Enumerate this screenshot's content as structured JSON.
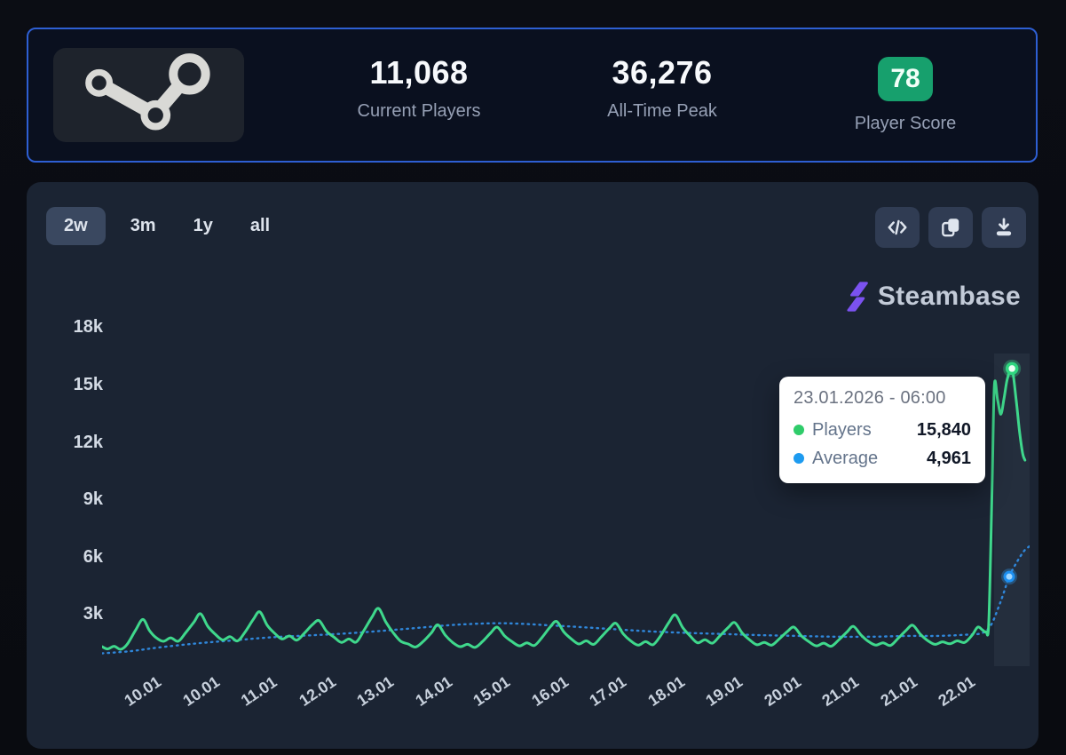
{
  "header": {
    "current_players": "11,068",
    "current_players_label": "Current Players",
    "all_time_peak": "36,276",
    "all_time_peak_label": "All-Time Peak",
    "player_score": "78",
    "player_score_label": "Player Score",
    "score_color": "#17a06d"
  },
  "toolbar": {
    "ranges": [
      {
        "label": "2w",
        "active": true
      },
      {
        "label": "3m",
        "active": false
      },
      {
        "label": "1y",
        "active": false
      },
      {
        "label": "all",
        "active": false
      }
    ],
    "icon_buttons": [
      "embed-code",
      "copy",
      "download"
    ]
  },
  "brand": {
    "name": "Steambase",
    "glyph_color": "#7b52f0"
  },
  "tooltip": {
    "date": "23.01.2026 - 06:00",
    "rows": [
      {
        "label": "Players",
        "value": "15,840",
        "color": "#2fcc6a"
      },
      {
        "label": "Average",
        "value": "4,961",
        "color": "#1d9bf0"
      }
    ]
  },
  "chart_data": {
    "type": "line",
    "ylim": [
      0,
      18400
    ],
    "y_ticks": [
      "18k",
      "15k",
      "12k",
      "9k",
      "6k",
      "3k"
    ],
    "y_tick_values": [
      18000,
      15000,
      12000,
      9000,
      6000,
      3000
    ],
    "x_ticks": [
      "10.01",
      "10.01",
      "11.01",
      "12.01",
      "13.01",
      "14.01",
      "15.01",
      "16.01",
      "17.01",
      "18.01",
      "19.01",
      "20.01",
      "21.01",
      "21.01",
      "22.01"
    ],
    "legend_position": "tooltip",
    "grid": false,
    "series": [
      {
        "name": "Players",
        "color": "#3fd88c",
        "style": "solid",
        "points": [
          [
            0.0,
            1300
          ],
          [
            0.006,
            1180
          ],
          [
            0.013,
            1320
          ],
          [
            0.02,
            1160
          ],
          [
            0.027,
            1420
          ],
          [
            0.036,
            2150
          ],
          [
            0.044,
            2720
          ],
          [
            0.051,
            2150
          ],
          [
            0.058,
            1780
          ],
          [
            0.066,
            1580
          ],
          [
            0.074,
            1760
          ],
          [
            0.082,
            1580
          ],
          [
            0.09,
            2020
          ],
          [
            0.099,
            2580
          ],
          [
            0.106,
            3020
          ],
          [
            0.114,
            2360
          ],
          [
            0.122,
            1950
          ],
          [
            0.13,
            1650
          ],
          [
            0.138,
            1820
          ],
          [
            0.146,
            1600
          ],
          [
            0.154,
            2050
          ],
          [
            0.163,
            2720
          ],
          [
            0.17,
            3120
          ],
          [
            0.178,
            2420
          ],
          [
            0.186,
            2000
          ],
          [
            0.194,
            1700
          ],
          [
            0.202,
            1860
          ],
          [
            0.21,
            1640
          ],
          [
            0.218,
            2000
          ],
          [
            0.227,
            2460
          ],
          [
            0.234,
            2660
          ],
          [
            0.242,
            2100
          ],
          [
            0.25,
            1800
          ],
          [
            0.258,
            1520
          ],
          [
            0.266,
            1700
          ],
          [
            0.274,
            1540
          ],
          [
            0.282,
            2120
          ],
          [
            0.291,
            2850
          ],
          [
            0.298,
            3300
          ],
          [
            0.306,
            2580
          ],
          [
            0.314,
            2020
          ],
          [
            0.322,
            1580
          ],
          [
            0.33,
            1440
          ],
          [
            0.338,
            1280
          ],
          [
            0.346,
            1560
          ],
          [
            0.355,
            2020
          ],
          [
            0.362,
            2440
          ],
          [
            0.37,
            1900
          ],
          [
            0.378,
            1520
          ],
          [
            0.386,
            1300
          ],
          [
            0.394,
            1420
          ],
          [
            0.402,
            1260
          ],
          [
            0.41,
            1560
          ],
          [
            0.419,
            2020
          ],
          [
            0.426,
            2320
          ],
          [
            0.434,
            1860
          ],
          [
            0.442,
            1560
          ],
          [
            0.45,
            1340
          ],
          [
            0.458,
            1500
          ],
          [
            0.466,
            1360
          ],
          [
            0.474,
            1760
          ],
          [
            0.483,
            2320
          ],
          [
            0.49,
            2620
          ],
          [
            0.498,
            2060
          ],
          [
            0.506,
            1700
          ],
          [
            0.514,
            1440
          ],
          [
            0.522,
            1600
          ],
          [
            0.53,
            1420
          ],
          [
            0.538,
            1800
          ],
          [
            0.547,
            2260
          ],
          [
            0.554,
            2520
          ],
          [
            0.562,
            1960
          ],
          [
            0.57,
            1600
          ],
          [
            0.578,
            1380
          ],
          [
            0.586,
            1560
          ],
          [
            0.594,
            1400
          ],
          [
            0.602,
            1860
          ],
          [
            0.611,
            2560
          ],
          [
            0.618,
            2960
          ],
          [
            0.626,
            2300
          ],
          [
            0.634,
            1860
          ],
          [
            0.642,
            1500
          ],
          [
            0.65,
            1660
          ],
          [
            0.658,
            1480
          ],
          [
            0.666,
            1860
          ],
          [
            0.675,
            2300
          ],
          [
            0.682,
            2560
          ],
          [
            0.69,
            2020
          ],
          [
            0.698,
            1660
          ],
          [
            0.706,
            1400
          ],
          [
            0.714,
            1520
          ],
          [
            0.722,
            1380
          ],
          [
            0.73,
            1700
          ],
          [
            0.739,
            2100
          ],
          [
            0.746,
            2320
          ],
          [
            0.754,
            1860
          ],
          [
            0.762,
            1560
          ],
          [
            0.77,
            1340
          ],
          [
            0.778,
            1480
          ],
          [
            0.786,
            1320
          ],
          [
            0.794,
            1640
          ],
          [
            0.803,
            2060
          ],
          [
            0.81,
            2360
          ],
          [
            0.818,
            1920
          ],
          [
            0.826,
            1580
          ],
          [
            0.834,
            1380
          ],
          [
            0.842,
            1500
          ],
          [
            0.85,
            1360
          ],
          [
            0.858,
            1720
          ],
          [
            0.867,
            2160
          ],
          [
            0.874,
            2420
          ],
          [
            0.882,
            1960
          ],
          [
            0.89,
            1620
          ],
          [
            0.898,
            1420
          ],
          [
            0.906,
            1550
          ],
          [
            0.914,
            1450
          ],
          [
            0.922,
            1600
          ],
          [
            0.93,
            1520
          ],
          [
            0.938,
            1900
          ],
          [
            0.944,
            2320
          ],
          [
            0.949,
            2180
          ],
          [
            0.953,
            2080
          ],
          [
            0.956,
            2600
          ],
          [
            0.9595,
            9500
          ],
          [
            0.962,
            14950
          ],
          [
            0.9655,
            14200
          ],
          [
            0.969,
            13450
          ],
          [
            0.9725,
            14300
          ],
          [
            0.976,
            15300
          ],
          [
            0.981,
            15840
          ],
          [
            0.9855,
            14200
          ],
          [
            0.989,
            12600
          ],
          [
            0.9925,
            11400
          ],
          [
            0.995,
            11050
          ]
        ]
      },
      {
        "name": "Average",
        "color": "#2f86d9",
        "style": "dashed",
        "points": [
          [
            0.0,
            950
          ],
          [
            0.03,
            1060
          ],
          [
            0.06,
            1250
          ],
          [
            0.1,
            1460
          ],
          [
            0.14,
            1620
          ],
          [
            0.18,
            1780
          ],
          [
            0.22,
            1880
          ],
          [
            0.26,
            1980
          ],
          [
            0.3,
            2120
          ],
          [
            0.34,
            2280
          ],
          [
            0.38,
            2440
          ],
          [
            0.42,
            2520
          ],
          [
            0.45,
            2500
          ],
          [
            0.48,
            2420
          ],
          [
            0.51,
            2340
          ],
          [
            0.55,
            2220
          ],
          [
            0.59,
            2100
          ],
          [
            0.63,
            2020
          ],
          [
            0.67,
            1960
          ],
          [
            0.71,
            1900
          ],
          [
            0.75,
            1860
          ],
          [
            0.79,
            1820
          ],
          [
            0.83,
            1820
          ],
          [
            0.87,
            1860
          ],
          [
            0.9,
            1860
          ],
          [
            0.93,
            1920
          ],
          [
            0.948,
            2000
          ],
          [
            0.958,
            2400
          ],
          [
            0.966,
            3300
          ],
          [
            0.972,
            4100
          ],
          [
            0.978,
            4961
          ],
          [
            0.986,
            5700
          ],
          [
            0.994,
            6300
          ],
          [
            1.0,
            6550
          ]
        ]
      }
    ],
    "markers": [
      {
        "series": "Players",
        "x": 0.981,
        "value": 15840
      },
      {
        "series": "Average",
        "x": 0.978,
        "value": 4961
      }
    ]
  }
}
